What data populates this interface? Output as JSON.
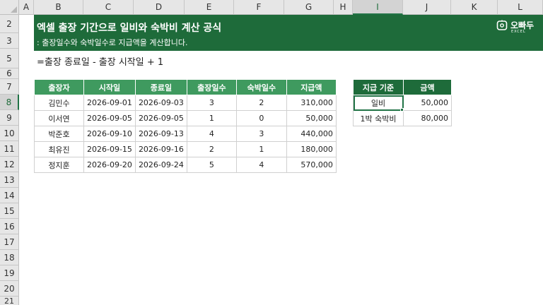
{
  "sheet": {
    "columns": [
      "A",
      "B",
      "C",
      "D",
      "E",
      "F",
      "G",
      "H",
      "I",
      "J",
      "K",
      "L"
    ],
    "selected_column": "I",
    "rows": [
      "2",
      "3",
      "5",
      "6",
      "7",
      "8",
      "9",
      "10",
      "11",
      "12",
      "13",
      "14",
      "15",
      "16",
      "17",
      "18",
      "19",
      "20",
      "21"
    ],
    "selected_row": "8"
  },
  "banner": {
    "title": "엑셀 출장 기간으로 일비와 숙박비 계산 공식",
    "subtitle": ": 출장일수와 숙박일수로 지급액을 계산합니다.",
    "logo_text": "오빠두",
    "logo_sub": "EXCEL",
    "icon": "owl-logo-icon",
    "color": "#1e6b3a"
  },
  "formula_text": "=출장 종료일 - 출장 시작일 + 1",
  "trip_table": {
    "headers": [
      "출장자",
      "시작일",
      "종료일",
      "출장일수",
      "숙박일수",
      "지급액"
    ],
    "rows": [
      [
        "김민수",
        "2026-09-01",
        "2026-09-03",
        "3",
        "2",
        "310,000"
      ],
      [
        "이서연",
        "2026-09-05",
        "2026-09-05",
        "1",
        "0",
        "50,000"
      ],
      [
        "박준호",
        "2026-09-10",
        "2026-09-13",
        "4",
        "3",
        "440,000"
      ],
      [
        "최유진",
        "2026-09-15",
        "2026-09-16",
        "2",
        "1",
        "180,000"
      ],
      [
        "정지훈",
        "2026-09-20",
        "2026-09-24",
        "5",
        "4",
        "570,000"
      ]
    ],
    "header_color": "#3f9a5f"
  },
  "rate_table": {
    "headers": [
      "지급 기준",
      "금액"
    ],
    "rows": [
      [
        "일비",
        "50,000"
      ],
      [
        "1박 숙박비",
        "80,000"
      ]
    ],
    "header_color": "#1e6b3a"
  }
}
